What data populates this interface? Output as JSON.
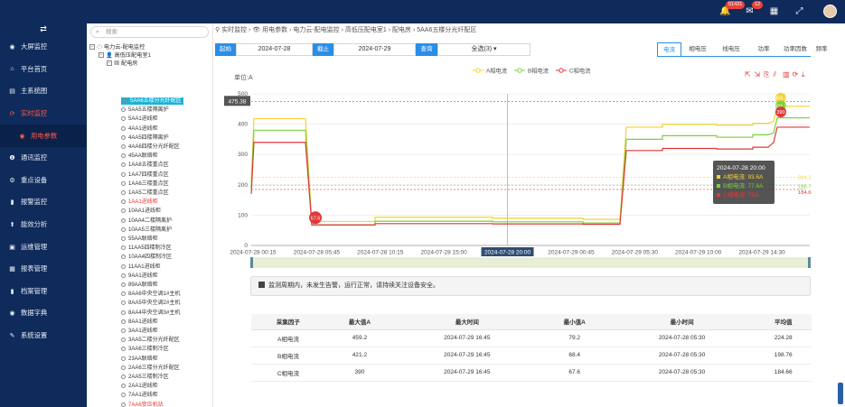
{
  "topbar": {
    "badge_msg": "51431",
    "badge_mail": "12"
  },
  "sidebar": {
    "toggle_icon": "⇄",
    "items": [
      {
        "label": "大屏监控",
        "icon": "circle-icon"
      },
      {
        "label": "平台首页",
        "icon": "home-icon"
      },
      {
        "label": "主系统图",
        "icon": "grid-icon"
      },
      {
        "label": "实时监控",
        "icon": "sync-icon",
        "active": true
      },
      {
        "label": "用电参数",
        "icon": "eye-icon",
        "sub": true
      },
      {
        "label": "通讯监控",
        "icon": "info-icon"
      },
      {
        "label": "重点设备",
        "icon": "settings-icon"
      },
      {
        "label": "报警监控",
        "icon": "bookmark-icon"
      },
      {
        "label": "能效分析",
        "icon": "trend-icon"
      },
      {
        "label": "运维管理",
        "icon": "inbox-icon"
      },
      {
        "label": "报表管理",
        "icon": "calendar-icon"
      },
      {
        "label": "档案管理",
        "icon": "bookmark-icon"
      },
      {
        "label": "数据字典",
        "icon": "circle-icon"
      },
      {
        "label": "系统设置",
        "icon": "wrench-icon"
      }
    ]
  },
  "tree": {
    "search_placeholder": "搜索",
    "root": "电力云-配电监控",
    "level1": "高低压配电室1",
    "level2": "配电房",
    "leaves": [
      {
        "label": "5AA6五楼分光纤配区",
        "state": "sel"
      },
      {
        "label": "5AA5五楼隔离护",
        "state": ""
      },
      {
        "label": "5AA1进线柜",
        "state": ""
      },
      {
        "label": "4AA1进线柜",
        "state": ""
      },
      {
        "label": "4AA5四楼隔离护",
        "state": ""
      },
      {
        "label": "4AA6四楼分光纤配区",
        "state": ""
      },
      {
        "label": "45AA联络柜",
        "state": ""
      },
      {
        "label": "1AA8五楼重点区",
        "state": ""
      },
      {
        "label": "1AA7四楼重点区",
        "state": ""
      },
      {
        "label": "1AA6三楼重点区",
        "state": ""
      },
      {
        "label": "1AA5二楼重点区",
        "state": ""
      },
      {
        "label": "1AA1进线柜",
        "state": "red"
      },
      {
        "label": "10AA1进线柜",
        "state": ""
      },
      {
        "label": "10AA4二楼隔离护",
        "state": ""
      },
      {
        "label": "10AA5三楼隔离护",
        "state": ""
      },
      {
        "label": "55AA联络柜",
        "state": ""
      },
      {
        "label": "11AA5四楼制冷区",
        "state": ""
      },
      {
        "label": "10AA4四楼制冷区",
        "state": ""
      },
      {
        "label": "11AA1进线柜",
        "state": ""
      },
      {
        "label": "9AA1进线柜",
        "state": ""
      },
      {
        "label": "89AA联络柜",
        "state": ""
      },
      {
        "label": "8AA6中央空调1#主机",
        "state": ""
      },
      {
        "label": "8AA5中央空调2#主机",
        "state": ""
      },
      {
        "label": "8AA4中央空调3#主机",
        "state": ""
      },
      {
        "label": "8AA1进线柜",
        "state": ""
      },
      {
        "label": "3AA1进线柜",
        "state": ""
      },
      {
        "label": "3AA5二楼分光纤配区",
        "state": ""
      },
      {
        "label": "3AA6三楼制冷区",
        "state": ""
      },
      {
        "label": "23AA联络柜",
        "state": ""
      },
      {
        "label": "2AA6三楼分光纤配区",
        "state": ""
      },
      {
        "label": "2AA5三楼制冷区",
        "state": ""
      },
      {
        "label": "2AA1进线柜",
        "state": ""
      },
      {
        "label": "7AA1进线柜",
        "state": ""
      },
      {
        "label": "7AA6变压机站",
        "state": "red"
      }
    ]
  },
  "breadcrumb": "⚲ 实时监控 › 👁 用电参数 › 电力云-配电监控 › 高低压配电室1 › 配电房 › 5AA6五楼分光纤配区",
  "filter": {
    "start_label": "起始",
    "start_date": "2024-07-28",
    "end_label": "截止",
    "end_date": "2024-07-29",
    "query_label": "查询",
    "select_value": "全选(3)"
  },
  "tabs": [
    "电流",
    "相电压",
    "线电压",
    "功率",
    "功率因数",
    "频率"
  ],
  "chart_data": {
    "type": "line",
    "unit_label": "单位:A",
    "ylim": [
      0,
      500
    ],
    "yticks": [
      0,
      100,
      200,
      300,
      400,
      500
    ],
    "x_ticks": [
      "2024-07-28 00:15",
      "2024-07-28 05:45",
      "2024-07-28 10:15",
      "2024-07-28 15:00",
      "2024-07-28 20:00",
      "2024-07-29 00:45",
      "2024-07-29 05:30",
      "2024-07-29 10:00",
      "2024-07-29 14:30"
    ],
    "grid": true,
    "legend_position": "top",
    "cursor_y_label": "475.38",
    "series": [
      {
        "name": "A相电流",
        "color": "#f5d232",
        "start": 418,
        "low": [
          79,
          93,
          90,
          86
        ],
        "high": [
          390,
          400,
          397,
          403
        ],
        "end": 459.2,
        "avg": 224.28,
        "max_label": "459.2",
        "min_label": "79.2"
      },
      {
        "name": "B相电流",
        "color": "#7ad23b",
        "start": 380,
        "low": [
          68,
          80,
          78,
          74
        ],
        "high": [
          350,
          362,
          357,
          365
        ],
        "end": 421.2,
        "avg": 198.76,
        "max_label": "421.2",
        "min_label": "68.4"
      },
      {
        "name": "C相电流",
        "color": "#e03838",
        "start": 340,
        "low": [
          67.6,
          72,
          71,
          70
        ],
        "high": [
          313,
          320,
          318,
          324
        ],
        "end": 390,
        "avg": 184.66,
        "max_label": "390",
        "min_label": "67.6"
      }
    ],
    "tooltip": {
      "time": "2024-07-28 20:00",
      "rows": [
        "A相电流: 93.6A",
        "B相电流: 77.6A",
        "C相电流: 75A"
      ]
    },
    "avg_labels": [
      "224.28",
      "198.76",
      "184.66"
    ],
    "min_pin_label": "67.6"
  },
  "notice": "监测周期内，未发生告警，运行正常，请持续关注设备安全。",
  "table": {
    "headers": [
      "采集因子",
      "最大值A",
      "最大时间",
      "最小值A",
      "最小时间",
      "平均值"
    ],
    "rows": [
      [
        "A相电流",
        "459.2",
        "2024-07-29 16:45",
        "79.2",
        "2024-07-28 05:30",
        "224.28"
      ],
      [
        "B相电流",
        "421.2",
        "2024-07-29 16:45",
        "68.4",
        "2024-07-28 05:30",
        "198.76"
      ],
      [
        "C相电流",
        "390",
        "2024-07-29 16:45",
        "67.6",
        "2024-07-28 05:30",
        "184.66"
      ]
    ]
  }
}
